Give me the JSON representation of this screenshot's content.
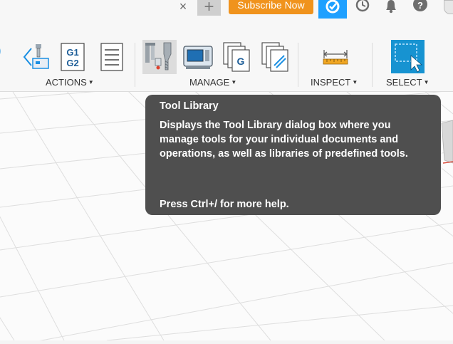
{
  "header": {
    "subscribe_label": "Subscribe Now",
    "close_glyph": "×",
    "plus_glyph": "+",
    "brand_orange": "#f0931d",
    "status_blue": "#1ea0ff"
  },
  "toolbar": {
    "groups": [
      {
        "label": "ACTIONS",
        "icons": [
          "simulate-icon",
          "post-process-g1g2-icon",
          "setup-sheet-icon"
        ]
      },
      {
        "label": "MANAGE",
        "icons": [
          "tool-library-icon",
          "machine-library-icon",
          "post-library-icon",
          "template-library-icon"
        ]
      },
      {
        "label": "INSPECT",
        "icons": [
          "measure-icon"
        ]
      },
      {
        "label": "SELECT",
        "icons": [
          "select-icon"
        ]
      }
    ],
    "g1g2_text": [
      "G1",
      "G2"
    ],
    "post_library_glyph": "G"
  },
  "tooltip": {
    "title": "Tool Library",
    "description": "Displays the Tool Library dialog box where you manage tools for your individual documents and operations, as well as libraries of predefined tools.",
    "help": "Press Ctrl+/ for more help."
  }
}
